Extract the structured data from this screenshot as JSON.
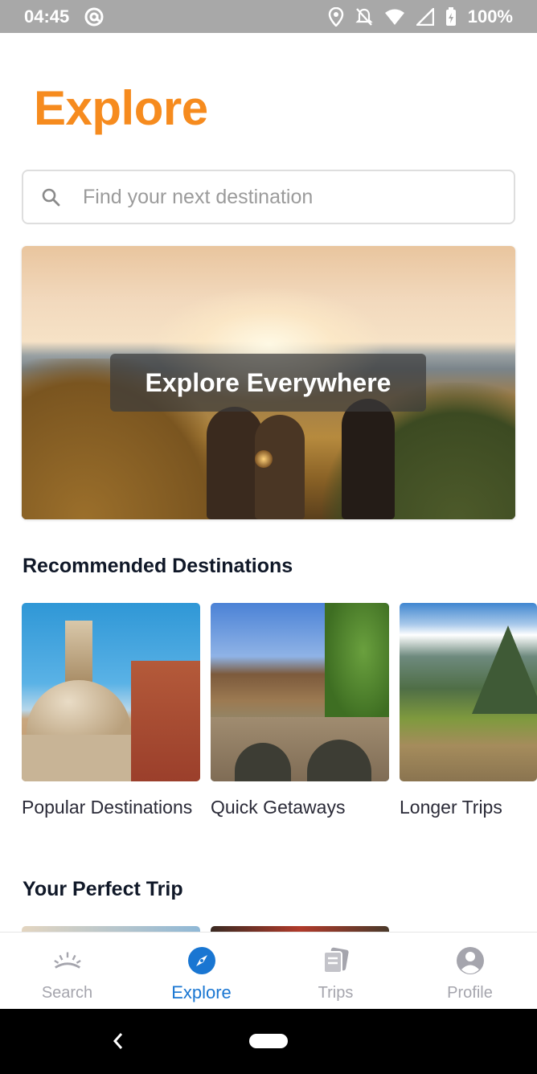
{
  "status_bar": {
    "time": "04:45",
    "battery": "100%"
  },
  "page": {
    "title": "Explore"
  },
  "search": {
    "placeholder": "Find your next destination"
  },
  "hero": {
    "label": "Explore Everywhere"
  },
  "recommended": {
    "title": "Recommended Destinations",
    "cards": [
      {
        "label": "Popular Destinations"
      },
      {
        "label": "Quick Getaways"
      },
      {
        "label": "Longer Trips"
      }
    ]
  },
  "perfect_trip": {
    "title": "Your Perfect Trip"
  },
  "bottom_nav": {
    "items": [
      {
        "label": "Search",
        "icon": "sunrise-icon",
        "active": false
      },
      {
        "label": "Explore",
        "icon": "compass-icon",
        "active": true
      },
      {
        "label": "Trips",
        "icon": "tickets-icon",
        "active": false
      },
      {
        "label": "Profile",
        "icon": "profile-icon",
        "active": false
      }
    ]
  },
  "colors": {
    "accent": "#f68b1e",
    "nav_active": "#1976d2",
    "nav_inactive": "#a5a5ad"
  }
}
